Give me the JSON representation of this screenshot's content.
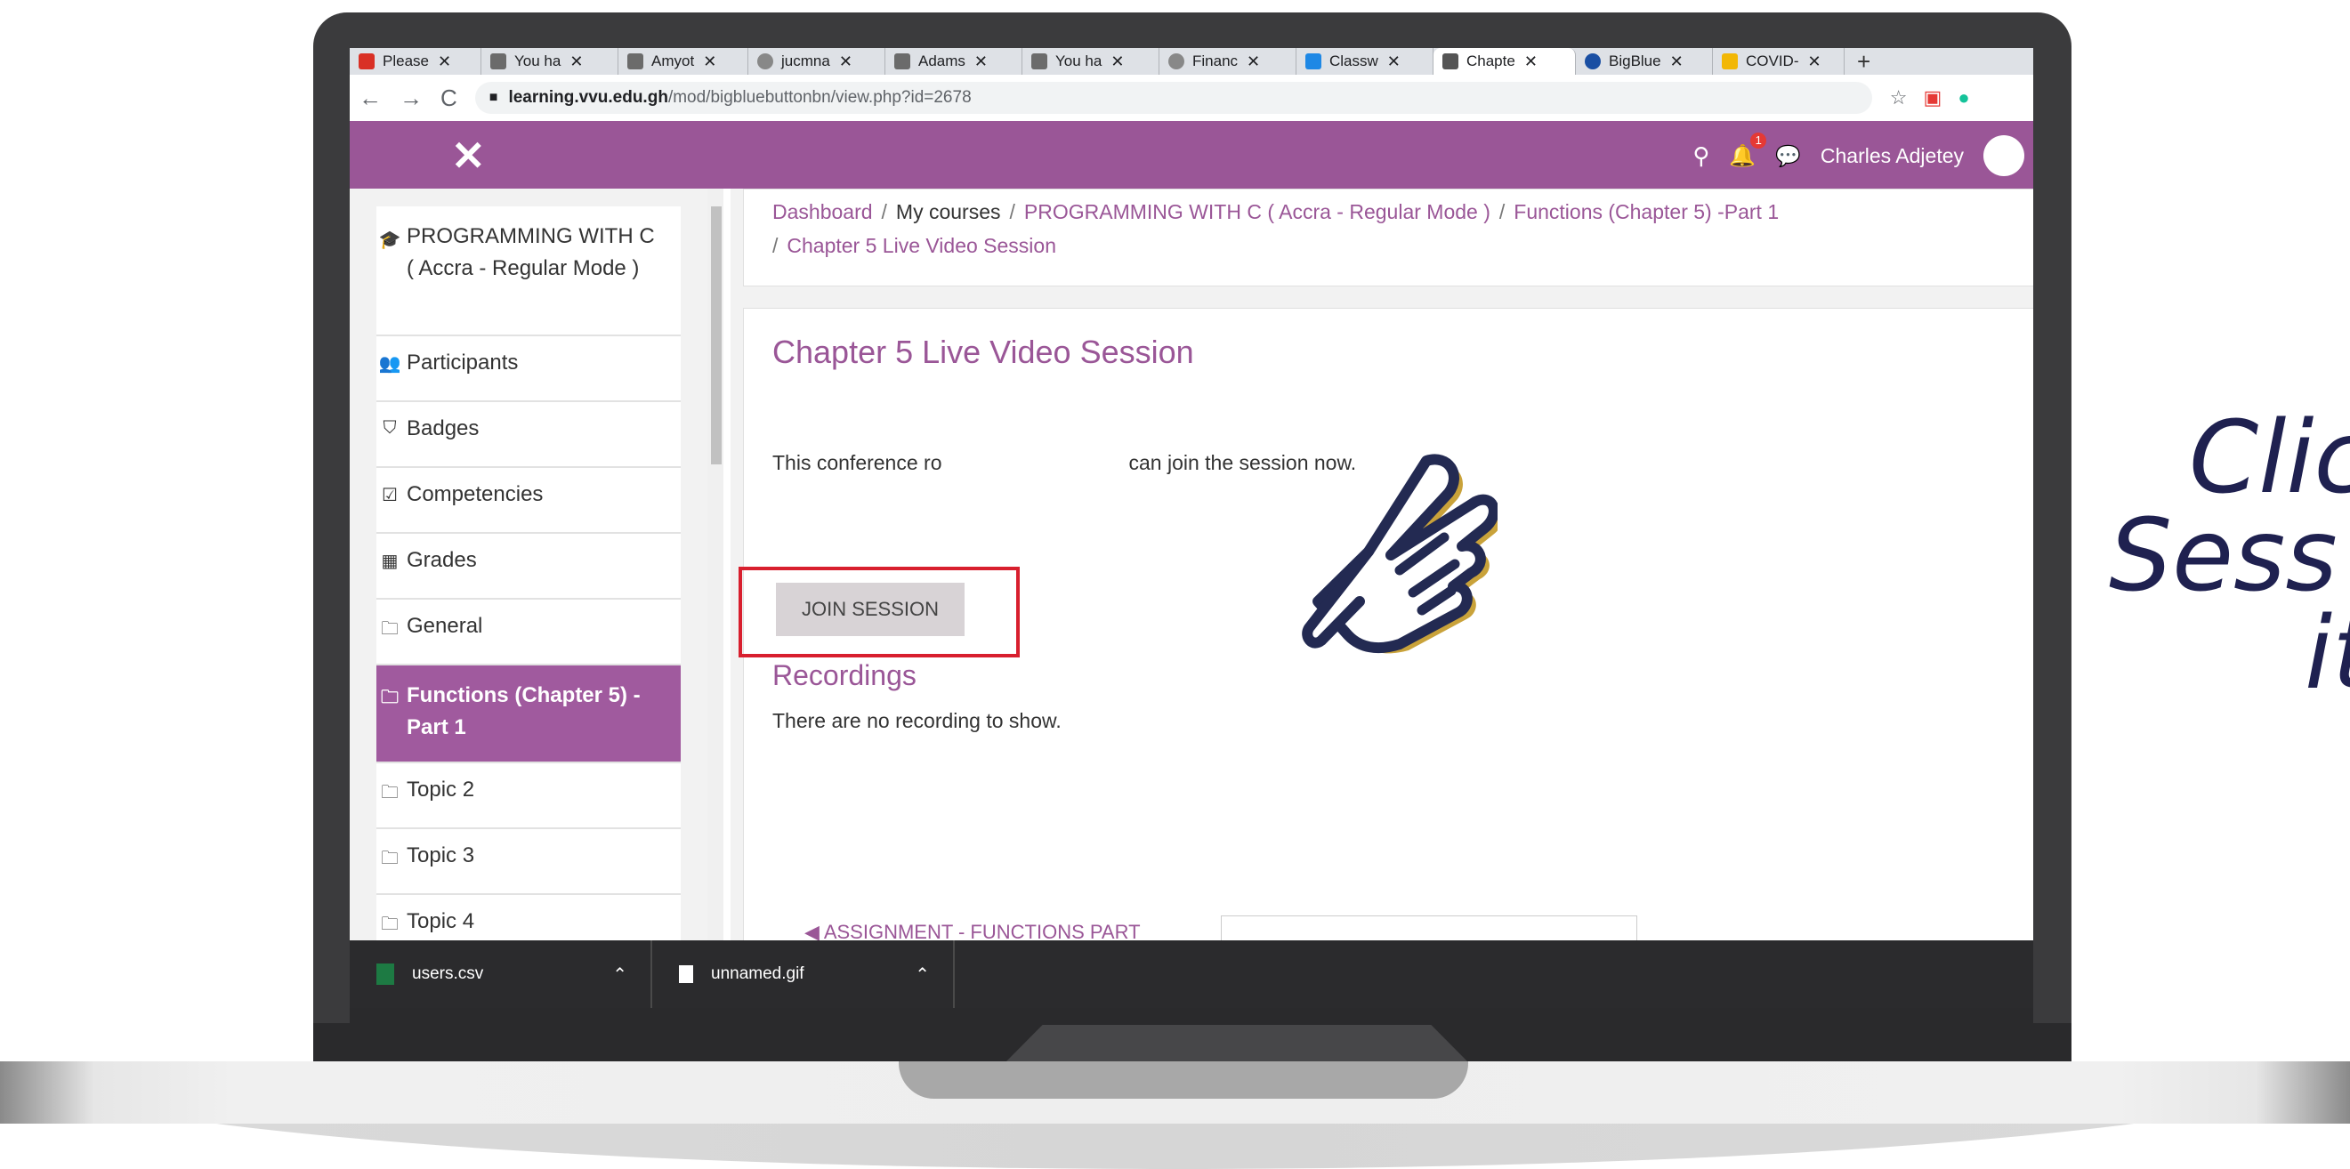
{
  "browser": {
    "tabs": [
      {
        "label": "Please",
        "icon": "gmail-icon",
        "color": "#d93025"
      },
      {
        "label": "You ha",
        "icon": "page-icon",
        "color": "#6b6b6b"
      },
      {
        "label": "Amyot",
        "icon": "page-icon",
        "color": "#6b6b6b"
      },
      {
        "label": "jucmna",
        "icon": "globe-icon",
        "color": "#888888"
      },
      {
        "label": "Adams",
        "icon": "page-icon",
        "color": "#6b6b6b"
      },
      {
        "label": "You ha",
        "icon": "page-icon",
        "color": "#6b6b6b"
      },
      {
        "label": "Financ",
        "icon": "globe-icon",
        "color": "#888888"
      },
      {
        "label": "Classw",
        "icon": "classroom-icon",
        "color": "#1e88e5"
      },
      {
        "label": "Chapte",
        "icon": "moodle-icon",
        "color": "#555555",
        "active": true
      },
      {
        "label": "BigBlue",
        "icon": "bigbluebutton-icon",
        "color": "#1a4fa3"
      },
      {
        "label": "COVID-",
        "icon": "covid-icon",
        "color": "#f2b705"
      }
    ],
    "new_tab": "+",
    "url_host": "learning.vvu.edu.gh",
    "url_path": "/mod/bigbluebuttonbn/view.php?id=2678"
  },
  "header": {
    "close": "✕",
    "user_name": "Charles Adjetey",
    "notification_count": "1"
  },
  "sidebar": {
    "items": [
      {
        "label": "PROGRAMMING WITH C ( Accra - Regular Mode )",
        "icon": "graduation-cap-icon",
        "glyph": "🎓"
      },
      {
        "label": "Participants",
        "icon": "users-icon",
        "glyph": "👥"
      },
      {
        "label": "Badges",
        "icon": "shield-icon",
        "glyph": "⛉"
      },
      {
        "label": "Competencies",
        "icon": "checkbox-icon",
        "glyph": "☑"
      },
      {
        "label": "Grades",
        "icon": "table-icon",
        "glyph": "▦"
      },
      {
        "label": "General",
        "icon": "folder-icon",
        "glyph": "🗀"
      },
      {
        "label": "Functions (Chapter 5) -Part 1",
        "icon": "folder-icon",
        "glyph": "🗀",
        "active": true
      },
      {
        "label": "Topic 2",
        "icon": "folder-icon",
        "glyph": "🗀"
      },
      {
        "label": "Topic 3",
        "icon": "folder-icon",
        "glyph": "🗀"
      },
      {
        "label": "Topic 4",
        "icon": "folder-icon",
        "glyph": "🗀"
      }
    ]
  },
  "breadcrumb": {
    "dashboard": "Dashboard",
    "my_courses": "My courses",
    "course": "PROGRAMMING WITH C ( Accra - Regular Mode )",
    "section": "Functions (Chapter 5) -Part 1",
    "page": "Chapter 5 Live Video Session"
  },
  "main": {
    "title": "Chapter 5 Live Video Session",
    "info_start": "This conference ro",
    "info_end": "can join the session now.",
    "join_button": "JOIN SESSION",
    "recordings_title": "Recordings",
    "recordings_text": "There are no recording to show.",
    "prev_link": "◀ ASSIGNMENT - FUNCTIONS PART"
  },
  "downloads": [
    {
      "name": "users.csv",
      "icon": "excel-icon",
      "color": "#1d7a43"
    },
    {
      "name": "unnamed.gif",
      "icon": "image-file-icon",
      "color": "#ffffff"
    }
  ],
  "caption": {
    "line1": "Clic",
    "line2": "Sess",
    "line3": "it"
  },
  "colors": {
    "moodle_purple": "#9a5697",
    "highlight_red": "#d81f2e",
    "caption_navy": "#1f2150"
  }
}
